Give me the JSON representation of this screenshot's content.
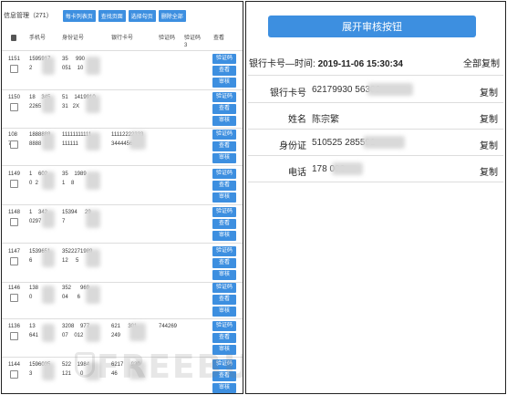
{
  "left": {
    "title": "信息管理（271）",
    "buttons": [
      "每卡列表页",
      "查找页面",
      "选择勾页",
      "删除全部"
    ],
    "headers": {
      "phone": "手机号",
      "id": "身份证号",
      "card": "银行卡号",
      "code1": "验证码",
      "code2": "验证码\n3",
      "view": "查看"
    },
    "action_labels": [
      "验证码",
      "查看",
      "审核"
    ],
    "rows": [
      {
        "num": "1151",
        "phone": "1595917\n2",
        "id": "35     990\n051    10",
        "card": "",
        "code": ""
      },
      {
        "num": "1150",
        "phone": "18    345\n2265",
        "id": "51    1419910\n31   2X",
        "card": "",
        "code": ""
      },
      {
        "num": "108\n7",
        "phone": "1888888\n8888",
        "id": "11111111111\n111111",
        "card": "11112222333\n34444567",
        "code": ""
      },
      {
        "num": "1149",
        "phone": "1    602\n0  2",
        "id": "35    1989\n1    8",
        "card": "",
        "code": ""
      },
      {
        "num": "1148",
        "phone": "1    342\n0297",
        "id": "15394     29\n7",
        "card": "",
        "code": ""
      },
      {
        "num": "1147",
        "phone": "1539651\n6",
        "id": "3522271989\n12     5",
        "card": "",
        "code": ""
      },
      {
        "num": "1146",
        "phone": "138\n0",
        "id": "352      969\n04      6",
        "card": "",
        "code": ""
      },
      {
        "num": "1136",
        "phone": "13\n641",
        "id": "3208    977\n07    012",
        "card": "621     301\n249",
        "code": "744269"
      },
      {
        "num": "1144",
        "phone": "1596035\n3",
        "id": "522    1984\n121      0",
        "card": "6217     930\n46",
        "code": ""
      }
    ]
  },
  "right": {
    "expand_label": "展开审核按钮",
    "info_label": "银行卡号—时间:",
    "info_time": "2019-11-06 15:30:34",
    "copy_all": "全部复制",
    "copy": "复制",
    "fields": [
      {
        "label": "银行卡号",
        "value": "62179930            56306"
      },
      {
        "label": "姓名",
        "value": "陈宗繁"
      },
      {
        "label": "身份证",
        "value": "510525            285591"
      },
      {
        "label": "电话",
        "value": "178          006"
      }
    ]
  },
  "watermark": "FREEBUF",
  "colors": {
    "accent": "#3d8fe0",
    "border": "#222222",
    "divider": "#dddddd"
  }
}
